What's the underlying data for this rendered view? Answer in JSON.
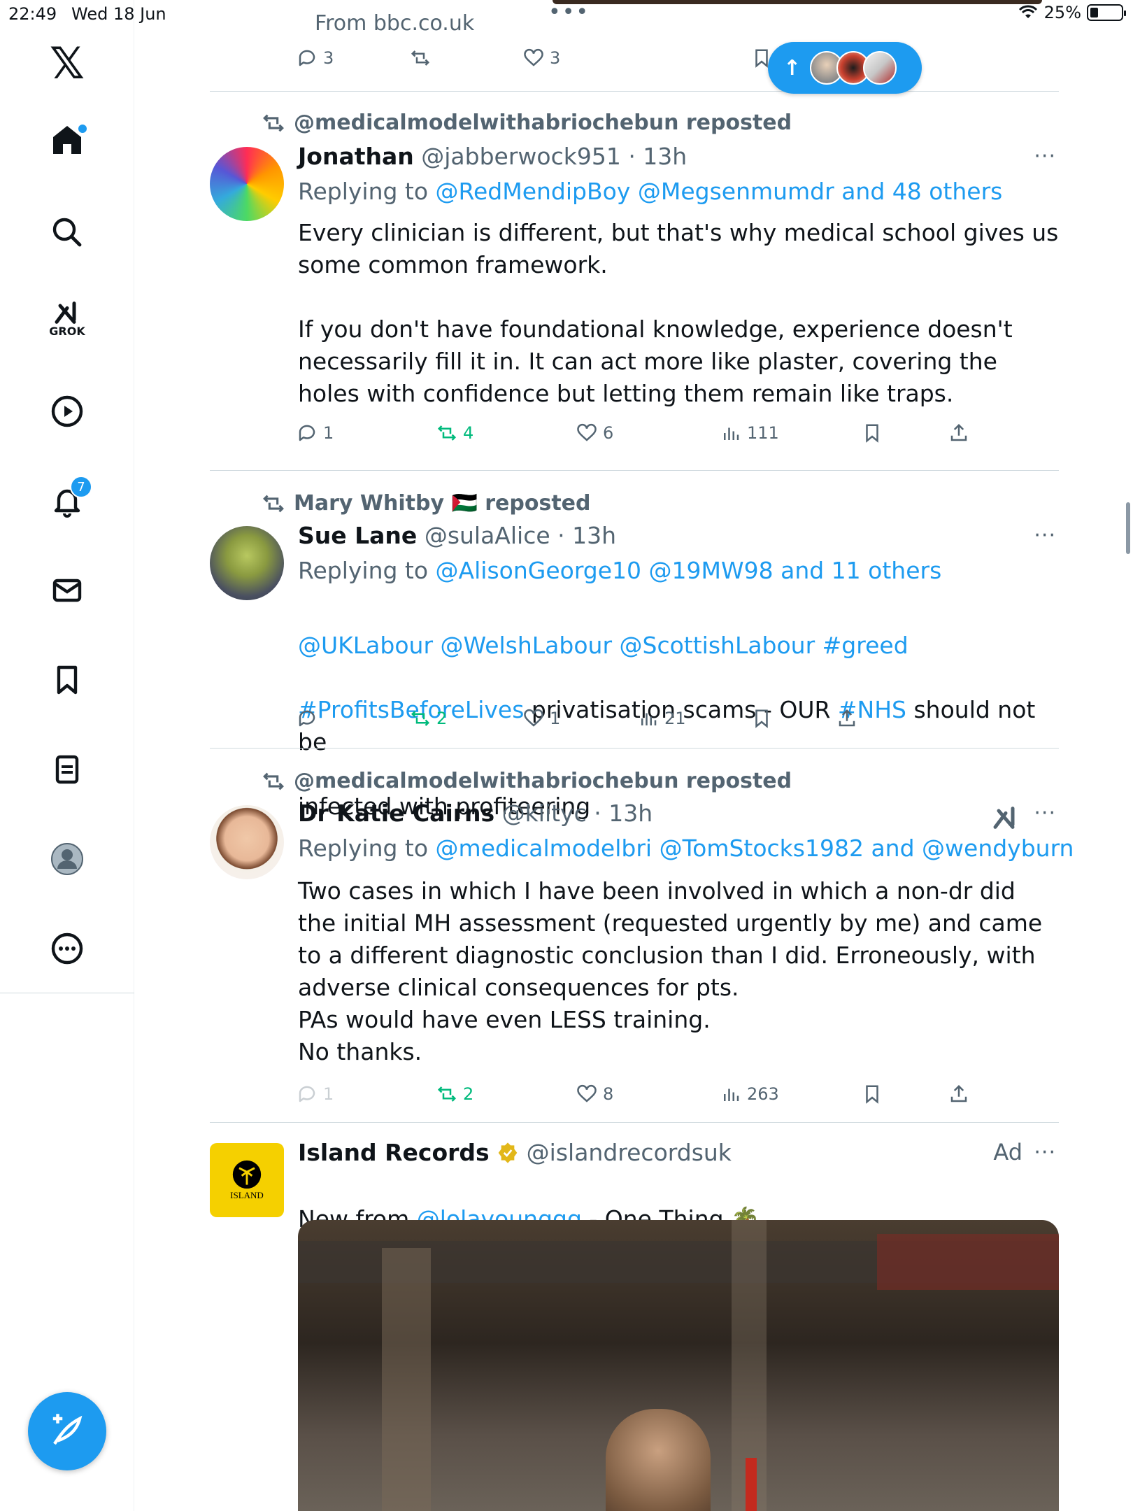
{
  "status_bar": {
    "time": "22:49",
    "date": "Wed 18 Jun",
    "battery": "25%"
  },
  "sidebar": {
    "logo": "𝕏",
    "grok_label": "GROK",
    "notifications_count": "7",
    "items": [
      "home-icon",
      "search-icon",
      "grok-icon",
      "video-icon",
      "notifications-icon",
      "messages-icon",
      "bookmarks-icon",
      "lists-icon",
      "profile-icon",
      "more-icon"
    ]
  },
  "top_tweet": {
    "source": "From bbc.co.uk",
    "replies": "3",
    "likes": "3"
  },
  "new_posts_pill": {
    "arrow": "↑"
  },
  "tweets": [
    {
      "reposted_by": "@medicalmodelwithabriochebun reposted",
      "name": "Jonathan",
      "handle": "@jabberwock951 · 13h",
      "replying_label": "Replying to",
      "replying_links": "@RedMendipBoy @Megsenmumdr and 48 others",
      "body": "Every clinician is different, but that's why medical school gives us some common framework.\n\nIf you don't have foundational knowledge, experience doesn't necessarily fill it in. It can act more like plaster, covering the holes with confidence but letting them remain like traps.",
      "replies": "1",
      "reposts": "4",
      "likes": "6",
      "views": "111"
    },
    {
      "reposted_by": "Mary Whitby 🇵🇸 reposted",
      "name": "Sue Lane",
      "handle": "@sulaAlice · 13h",
      "replying_label": "Replying to",
      "replying_links": "@AlisonGeorge10 @19MW98 and 11 others",
      "body_parts": {
        "line1": "@UKLabour @WelshLabour @ScottishLabour #greed",
        "hashtag2": "#ProfitsBeforeLives",
        "text2": " privatisation scams - OUR ",
        "hashtag3": "#NHS",
        "text3": " should not be",
        "line3": "infected with profiteering"
      },
      "replies": "",
      "reposts": "2",
      "likes": "1",
      "views": "21"
    },
    {
      "reposted_by": "@medicalmodelwithabriochebun reposted",
      "name": "Dr Katie Cairns",
      "handle": "@kiityc · 13h",
      "replying_label": "Replying to",
      "replying_links": "@medicalmodelbri @TomStocks1982 and @wendyburn",
      "body": "Two cases in which I have been involved in which a non-dr did the initial MH assessment (requested urgently by me) and came to a different diagnostic conclusion than I did. Erroneously, with adverse clinical consequences for pts.\nPAs would have even LESS training.\nNo thanks.",
      "replies": "1",
      "reposts": "2",
      "likes": "8",
      "views": "263"
    },
    {
      "name": "Island Records",
      "handle": "@islandrecordsuk",
      "ad_label": "Ad",
      "body_prefix": "New from ",
      "body_link": "@lolayounggg",
      "body_suffix": " - One Thing 🌴",
      "avatar_text": "ISLAND"
    }
  ],
  "more_glyph": "···",
  "colors": {
    "accent": "#1d9bf0",
    "repost_green": "#00ba7c",
    "secondary_text": "#536471",
    "island_yellow": "#f5d000"
  }
}
